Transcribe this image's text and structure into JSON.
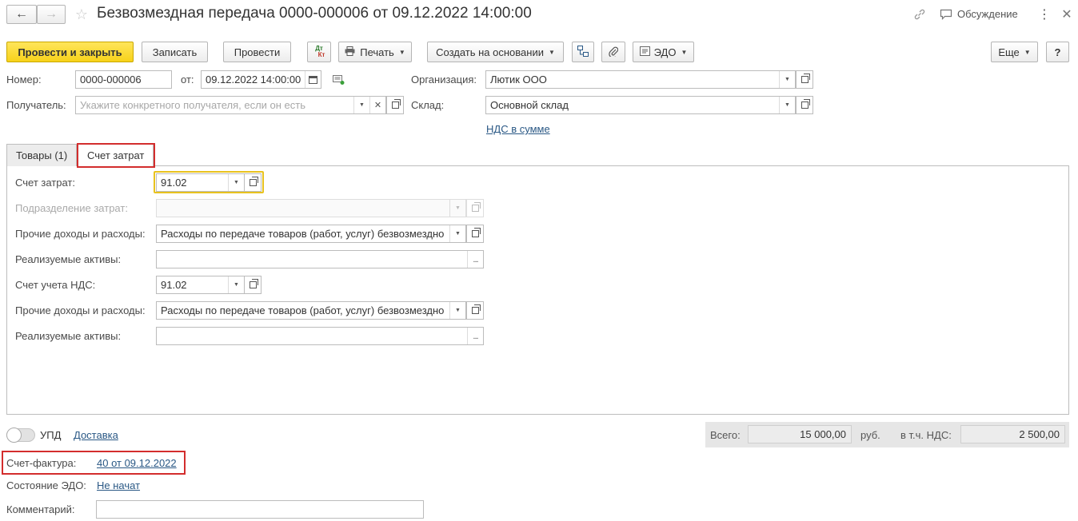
{
  "window": {
    "title": "Безвозмездная передача 0000-000006 от 09.12.2022 14:00:00",
    "discussion_label": "Обсуждение"
  },
  "toolbar": {
    "post_close": "Провести и закрыть",
    "save": "Записать",
    "post": "Провести",
    "dtkt_top": "Дт",
    "dtkt_bottom": "Кт",
    "print": "Печать",
    "create_based": "Создать на основании",
    "edo": "ЭДО",
    "more": "Еще",
    "help": "?"
  },
  "header": {
    "number_label": "Номер:",
    "number_value": "0000-000006",
    "date_label": "от:",
    "date_value": "09.12.2022 14:00:00",
    "org_label": "Организация:",
    "org_value": "Лютик ООО",
    "recipient_label": "Получатель:",
    "recipient_placeholder": "Укажите конкретного получателя, если он есть",
    "warehouse_label": "Склад:",
    "warehouse_value": "Основной склад",
    "vat_link": "НДС в сумме"
  },
  "tabs": [
    {
      "label": "Товары (1)",
      "active": false
    },
    {
      "label": "Счет затрат",
      "active": true
    }
  ],
  "cost_tab": {
    "cost_account_label": "Счет затрат:",
    "cost_account_value": "91.02",
    "division_label": "Подразделение затрат:",
    "other_ie_label_1": "Прочие доходы и расходы:",
    "other_ie_value_1": "Расходы по передаче товаров (работ, услуг) безвозмездно",
    "assets_label_1": "Реализуемые активы:",
    "vat_account_label": "Счет учета НДС:",
    "vat_account_value": "91.02",
    "other_ie_label_2": "Прочие доходы и расходы:",
    "other_ie_value_2": "Расходы по передаче товаров (работ, услуг) безвозмездно",
    "assets_label_2": "Реализуемые активы:"
  },
  "footer": {
    "upd_label": "УПД",
    "delivery_link": "Доставка",
    "total_label": "Всего:",
    "total_value": "15 000,00",
    "currency": "руб.",
    "vat_incl_label": "в т.ч. НДС:",
    "vat_value": "2 500,00",
    "invoice_label": "Счет-фактура:",
    "invoice_link": "40 от 09.12.2022",
    "edo_state_label": "Состояние ЭДО:",
    "edo_state_link": "Не начат",
    "comment_label": "Комментарий:",
    "comment_value": ""
  },
  "colors": {
    "primary_button": "#f7d21a",
    "highlight_red": "#d32d2d",
    "focus_yellow": "#e8c21e",
    "link": "#2a5885"
  }
}
